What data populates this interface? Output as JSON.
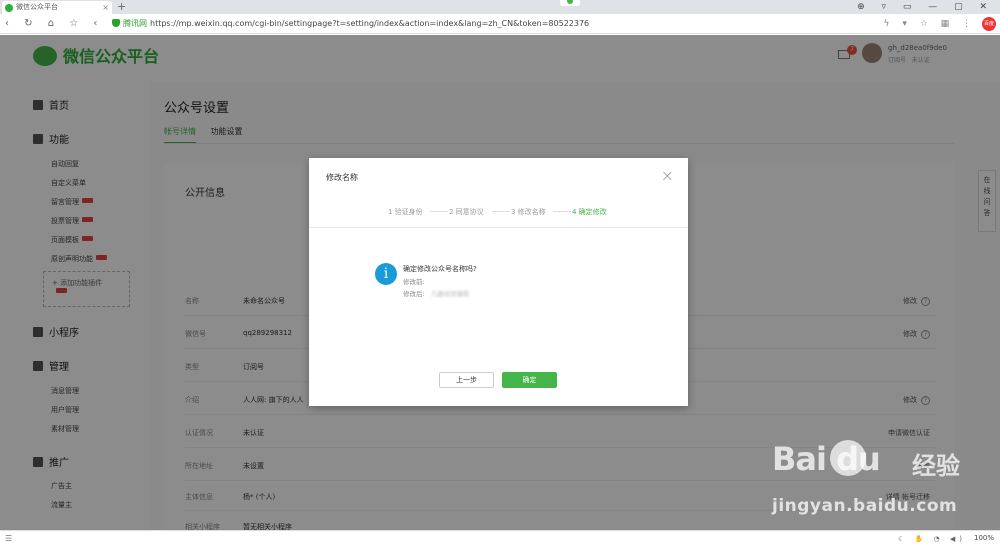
{
  "browser": {
    "tab_title": "微信公众平台",
    "tab_close": "×",
    "new_tab": "+",
    "window_controls": "⊕ ▿ ▭ — ▢ ✕",
    "nav_icons": "‹ ↻ ⌂ ☆ ‹",
    "secure_label": "腾讯网",
    "url": "https://mp.weixin.qq.com/cgi-bin/settingpage?t=setting/index&action=index&lang=zh_CN&token=80522376",
    "right_icons": "ϟ ▾ ☆ ▦ ⋮",
    "avatar_text": "百度"
  },
  "header": {
    "logo_text": "微信公众平台",
    "mail_count": "7",
    "user_name": "gh_d28ea0f9de0",
    "user_type": "订阅号",
    "user_status": "未认证"
  },
  "sidebar": {
    "home": "首页",
    "functions": "功能",
    "function_items": [
      "自动回复",
      "自定义菜单",
      "留言管理",
      "投票管理",
      "页面模板",
      "原创声明功能"
    ],
    "add_feature": "+ 添加功能插件",
    "miniprogram": "小程序",
    "manage": "管理",
    "manage_items": [
      "消息管理",
      "用户管理",
      "素材管理"
    ],
    "promote": "推广",
    "promote_items": [
      "广告主",
      "流量主"
    ]
  },
  "main": {
    "page_title": "公众号设置",
    "tabs": [
      "帐号详情",
      "功能设置"
    ],
    "section_title": "公开信息",
    "rows": [
      {
        "label": "名称",
        "value": "未命名公众号",
        "action": "修改"
      },
      {
        "label": "微信号",
        "value": "qq289298312",
        "action": "修改"
      },
      {
        "label": "类型",
        "value": "订阅号",
        "action": ""
      },
      {
        "label": "介绍",
        "value": "人人网: 旗下的人人",
        "action": "修改"
      },
      {
        "label": "认证情况",
        "value": "未认证",
        "action": "申请微信认证"
      },
      {
        "label": "所在地址",
        "value": "未设置",
        "action": "设置"
      },
      {
        "label": "主体信息",
        "value": "杨* (个人)",
        "action": "详情 帐号迁移"
      },
      {
        "label": "相关小程序",
        "value": "暂无相关小程序",
        "action": ""
      }
    ]
  },
  "online_question": "在线问答",
  "dialog": {
    "title": "修改名称",
    "close": "×",
    "steps": [
      "1 验证身份",
      "2 同意协议",
      "3 修改名称",
      "4 确定修改"
    ],
    "active_step": 4,
    "info_icon": "i",
    "question": "确定修改公众号名称吗?",
    "before_label": "修改前:",
    "after_label": "修改后:",
    "after_value": "凡趣视觉摄影",
    "prev_button": "上一步",
    "ok_button": "确定"
  },
  "statusbar": {
    "left_icon": "☰",
    "right_icons": "☾ ✋ ◔ ◀)",
    "zoom": "100%"
  },
  "watermark": {
    "brand": "Bai   du",
    "brand_cn": "经验",
    "url": "jingyan.baidu.com"
  },
  "colors": {
    "accent": "#44b549",
    "info": "#1a9bd9",
    "hot": "#e64340"
  }
}
